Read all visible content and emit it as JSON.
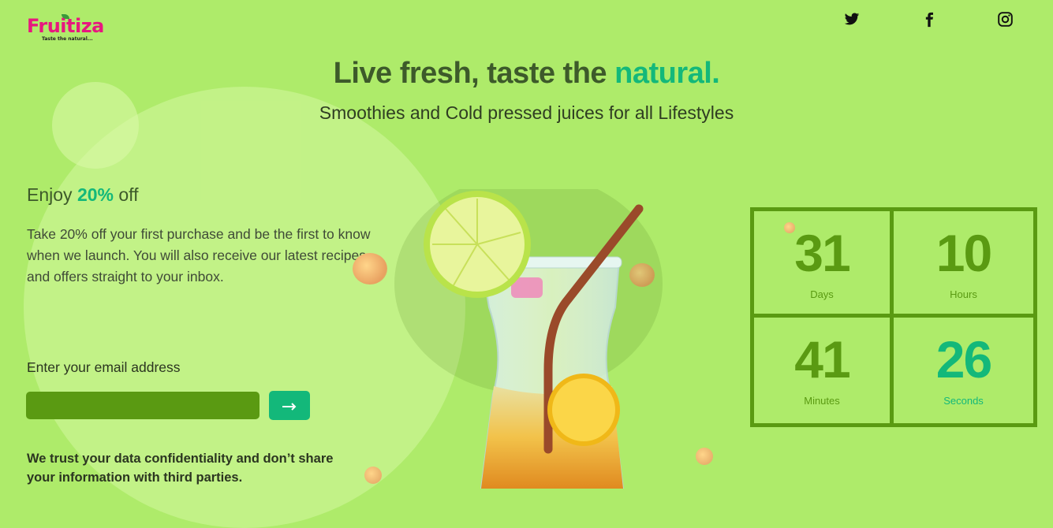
{
  "brand": {
    "name": "Fruitiza",
    "tagline": "Taste the natural..."
  },
  "social": {
    "icons": [
      "twitter-icon",
      "facebook-icon",
      "instagram-icon"
    ]
  },
  "hero": {
    "title_main": "Live fresh, taste the",
    "title_accent": "natural.",
    "subtitle": "Smoothies and Cold pressed juices for all Lifestyles"
  },
  "offer": {
    "head_prefix": "Enjoy",
    "head_accent": "20%",
    "head_suffix": "off",
    "text": "Take 20% off your first purchase and be the first to know when we launch. You will also receive our latest recipes and offers straight to your inbox.",
    "email_label": "Enter your email address",
    "email_value": "",
    "email_placeholder": "",
    "submit_icon": "arrow-right-icon",
    "trust_text": "We trust your data confidentiality and don’t share your information with third parties."
  },
  "countdown": [
    {
      "value": "31",
      "label": "Days"
    },
    {
      "value": "10",
      "label": "Hours"
    },
    {
      "value": "41",
      "label": "Minutes"
    },
    {
      "value": "26",
      "label": "Seconds"
    }
  ],
  "colors": {
    "background": "#aeeb6a",
    "accent": "#13b87a",
    "dark_green": "#5a9a12",
    "brand_pink": "#e8177f"
  }
}
